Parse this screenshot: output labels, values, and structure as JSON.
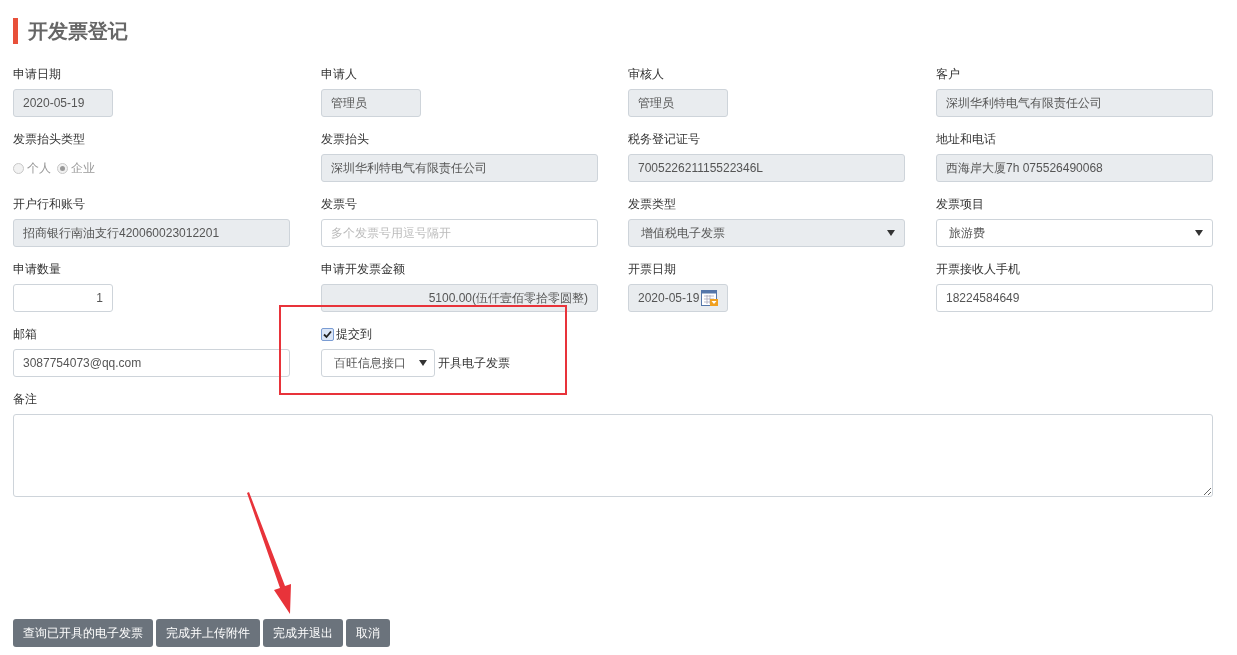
{
  "title": "开发票登记",
  "fields": [
    {
      "label": "申请日期",
      "kind": "text",
      "value": "2020-05-19",
      "readonly": true
    },
    {
      "label": "申请人",
      "kind": "text",
      "value": "管理员",
      "readonly": true
    },
    {
      "label": "审核人",
      "kind": "text",
      "value": "管理员",
      "readonly": true
    },
    {
      "label": "客户",
      "kind": "text",
      "value": "深圳华利特电气有限责任公司",
      "readonly": true
    },
    {
      "label": "发票抬头类型",
      "kind": "radio",
      "disabled": true,
      "options": [
        {
          "label": "个人",
          "selected": false
        },
        {
          "label": "企业",
          "selected": true
        }
      ]
    },
    {
      "label": "发票抬头",
      "kind": "text",
      "value": "深圳华利特电气有限责任公司",
      "readonly": true
    },
    {
      "label": "税务登记证号",
      "kind": "text",
      "value": "700522621115522346L",
      "readonly": true
    },
    {
      "label": "地址和电话",
      "kind": "text",
      "value": "西海岸大厦7h 075526490068",
      "readonly": true
    },
    {
      "label": "开户行和账号",
      "kind": "text",
      "value": "招商银行南油支行420060023012201",
      "readonly": true
    },
    {
      "label": "发票号",
      "kind": "text",
      "placeholder": "多个发票号用逗号隔开",
      "readonly": false
    },
    {
      "label": "发票类型",
      "kind": "select",
      "value": "增值税电子发票",
      "readonly": true
    },
    {
      "label": "发票项目",
      "kind": "select",
      "value": "旅游费",
      "readonly": false
    },
    {
      "label": "申请数量",
      "kind": "number",
      "value": "1",
      "readonly": false
    },
    {
      "label": "申请开发票金额",
      "kind": "number",
      "value": "5100.00(伍仟壹佰零拾零圆整)",
      "readonly": true
    },
    {
      "label": "开票日期",
      "kind": "date",
      "value": "2020-05-19",
      "readonly": true
    },
    {
      "label": "开票接收人手机",
      "kind": "text",
      "value": "18224584649",
      "readonly": false
    },
    {
      "label": "邮箱",
      "kind": "text",
      "value": "3087754073@qq.com",
      "readonly": false
    }
  ],
  "submit": {
    "checkbox": {
      "label": "提交到",
      "checked": true
    },
    "select": {
      "value": "百旺信息接口"
    },
    "suffix": "开具电子发票"
  },
  "remarks": {
    "label": "备注"
  },
  "buttons": [
    "查询已开具的电子发票",
    "完成并上传附件",
    "完成并退出",
    "取消"
  ]
}
